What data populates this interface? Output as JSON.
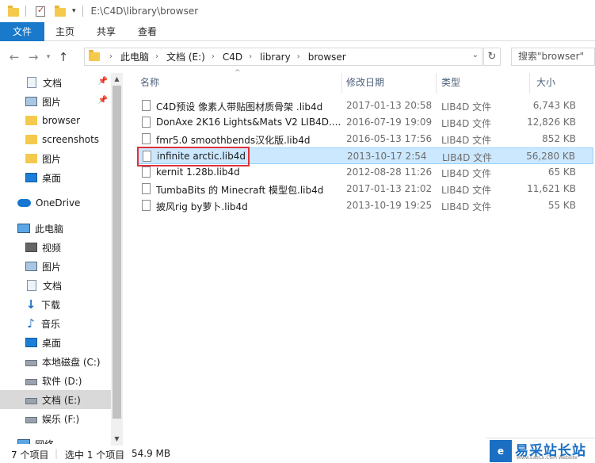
{
  "window": {
    "path_title": "E:\\C4D\\library\\browser"
  },
  "ribbon": {
    "tabs": [
      "文件",
      "主页",
      "共享",
      "查看"
    ]
  },
  "address": {
    "crumbs": [
      "此电脑",
      "文档 (E:)",
      "C4D",
      "library",
      "browser"
    ],
    "search_placeholder": "搜索\"browser\""
  },
  "sidebar": {
    "quick_access": [
      {
        "label": "文档",
        "icon": "document-icon",
        "pinned": true
      },
      {
        "label": "图片",
        "icon": "pictures-icon",
        "pinned": true
      },
      {
        "label": "browser",
        "icon": "folder-icon"
      },
      {
        "label": "screenshots",
        "icon": "folder-icon"
      },
      {
        "label": "图片",
        "icon": "folder-icon"
      },
      {
        "label": "桌面",
        "icon": "desktop-icon"
      }
    ],
    "onedrive": "OneDrive",
    "this_pc": "此电脑",
    "pc_items": [
      {
        "label": "视频",
        "icon": "video-icon"
      },
      {
        "label": "图片",
        "icon": "pictures-icon"
      },
      {
        "label": "文档",
        "icon": "document-icon"
      },
      {
        "label": "下载",
        "icon": "download-icon"
      },
      {
        "label": "音乐",
        "icon": "music-icon"
      },
      {
        "label": "桌面",
        "icon": "desktop-icon"
      },
      {
        "label": "本地磁盘 (C:)",
        "icon": "drive-icon"
      },
      {
        "label": "软件 (D:)",
        "icon": "drive-icon"
      },
      {
        "label": "文档 (E:)",
        "icon": "drive-icon",
        "selected": true
      },
      {
        "label": "娱乐 (F:)",
        "icon": "drive-icon"
      }
    ],
    "network": "网络"
  },
  "columns": {
    "name": "名称",
    "date": "修改日期",
    "type": "类型",
    "size": "大小"
  },
  "files": [
    {
      "name": "C4D预设 像素人带贴图材质骨架 .lib4d",
      "date": "2017-01-13 20:58",
      "type": "LIB4D 文件",
      "size": "6,743 KB"
    },
    {
      "name": "DonAxe 2K16 Lights&Mats V2 LIB4D....",
      "date": "2016-07-19 19:09",
      "type": "LIB4D 文件",
      "size": "12,826 KB"
    },
    {
      "name": "fmr5.0 smoothbends汉化版.lib4d",
      "date": "2016-05-13 17:56",
      "type": "LIB4D 文件",
      "size": "852 KB"
    },
    {
      "name": "infinite arctic.lib4d",
      "date": "2013-10-17 2:54",
      "type": "LIB4D 文件",
      "size": "56,280 KB",
      "selected": true
    },
    {
      "name": "kernit 1.28b.lib4d",
      "date": "2012-08-28 11:26",
      "type": "LIB4D 文件",
      "size": "65 KB"
    },
    {
      "name": "TumbaBits 的 Minecraft 模型包.lib4d",
      "date": "2017-01-13 21:02",
      "type": "LIB4D 文件",
      "size": "11,621 KB"
    },
    {
      "name": "披风rig by萝卜.lib4d",
      "date": "2013-10-19 19:25",
      "type": "LIB4D 文件",
      "size": "55 KB"
    }
  ],
  "status": {
    "count": "7 个项目",
    "selected": "选中 1 个项目",
    "size": "54.9 MB"
  },
  "watermark": {
    "text": "易采站长站",
    "sub": "Www.EasCk.Com  Website"
  }
}
